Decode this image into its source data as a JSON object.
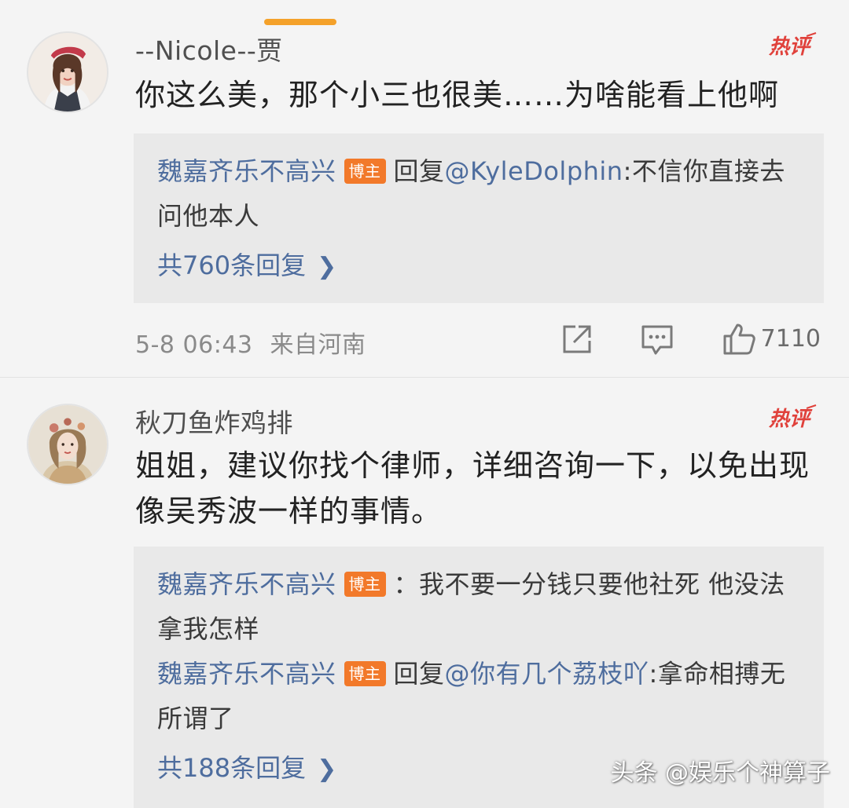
{
  "comments": [
    {
      "username": "--Nicole--贾",
      "badge": "热评",
      "text": "你这么美，那个小三也很美……为啥能看上他啊",
      "replies": [
        {
          "author": "魏嘉齐乐不高兴",
          "tag": "博主",
          "prefix": "回复",
          "mention": "@KyleDolphin",
          "body": ":不信你直接去问他本人"
        }
      ],
      "more_replies": "共760条回复",
      "time": "5-8 06:43",
      "location": "来自河南",
      "likes": "7110"
    },
    {
      "username": "秋刀鱼炸鸡排",
      "badge": "热评",
      "text": "姐姐，建议你找个律师，详细咨询一下，以免出现像吴秀波一样的事情。",
      "replies": [
        {
          "author": "魏嘉齐乐不高兴",
          "tag": "博主",
          "prefix": "",
          "mention": "",
          "body": "：我不要一分钱只要他社死 他没法拿我怎样"
        },
        {
          "author": "魏嘉齐乐不高兴",
          "tag": "博主",
          "prefix": "回复",
          "mention": "@你有几个荔枝吖",
          "body": ":拿命相搏无所谓了"
        }
      ],
      "more_replies": "共188条回复"
    }
  ],
  "icons": {
    "share": "share-icon",
    "comment": "comment-icon",
    "like": "thumbs-up-icon",
    "chevron": "chevron-right-icon"
  },
  "colors": {
    "link_blue": "#4e6d9e",
    "owner_tag": "#f2792a",
    "hot_red": "#e0413b",
    "tab_indicator": "#f4a12a"
  },
  "watermark": "头条 @娱乐个神算子"
}
